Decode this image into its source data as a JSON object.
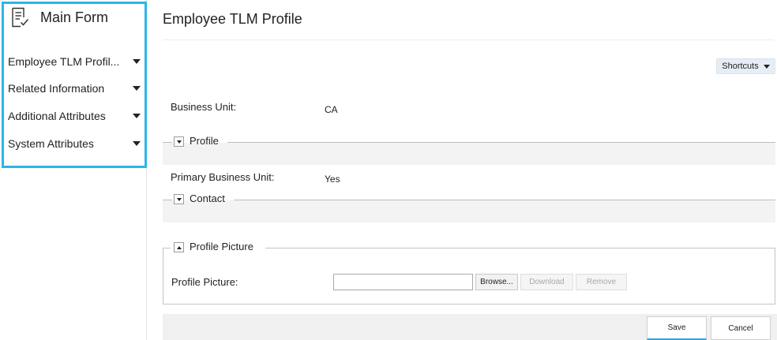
{
  "sidebar": {
    "title": "Main Form",
    "icon": "form-icon",
    "accent_color": "#29b6e8",
    "items": [
      {
        "label": "Employee TLM Profil...",
        "icon": "chevron-down-icon"
      },
      {
        "label": "Related Information",
        "icon": "chevron-down-icon"
      },
      {
        "label": "Additional Attributes",
        "icon": "chevron-down-icon"
      },
      {
        "label": "System Attributes",
        "icon": "chevron-down-icon"
      }
    ]
  },
  "main": {
    "title": "Employee TLM Profile",
    "shortcuts_label": "Shortcuts",
    "business_unit": {
      "label": "Business Unit:",
      "value": "CA"
    },
    "profile_section": {
      "title": "Profile",
      "collapsed": true
    },
    "primary_business_unit": {
      "label": "Primary Business Unit:",
      "value": "Yes"
    },
    "contact_section": {
      "title": "Contact",
      "collapsed": true
    },
    "profile_picture_section": {
      "title": "Profile Picture",
      "field_label": "Profile Picture:",
      "file_value": "",
      "browse_label": "Browse...",
      "download_label": "Download",
      "remove_label": "Remove"
    }
  },
  "footer": {
    "save_label": "Save",
    "cancel_label": "Cancel"
  }
}
